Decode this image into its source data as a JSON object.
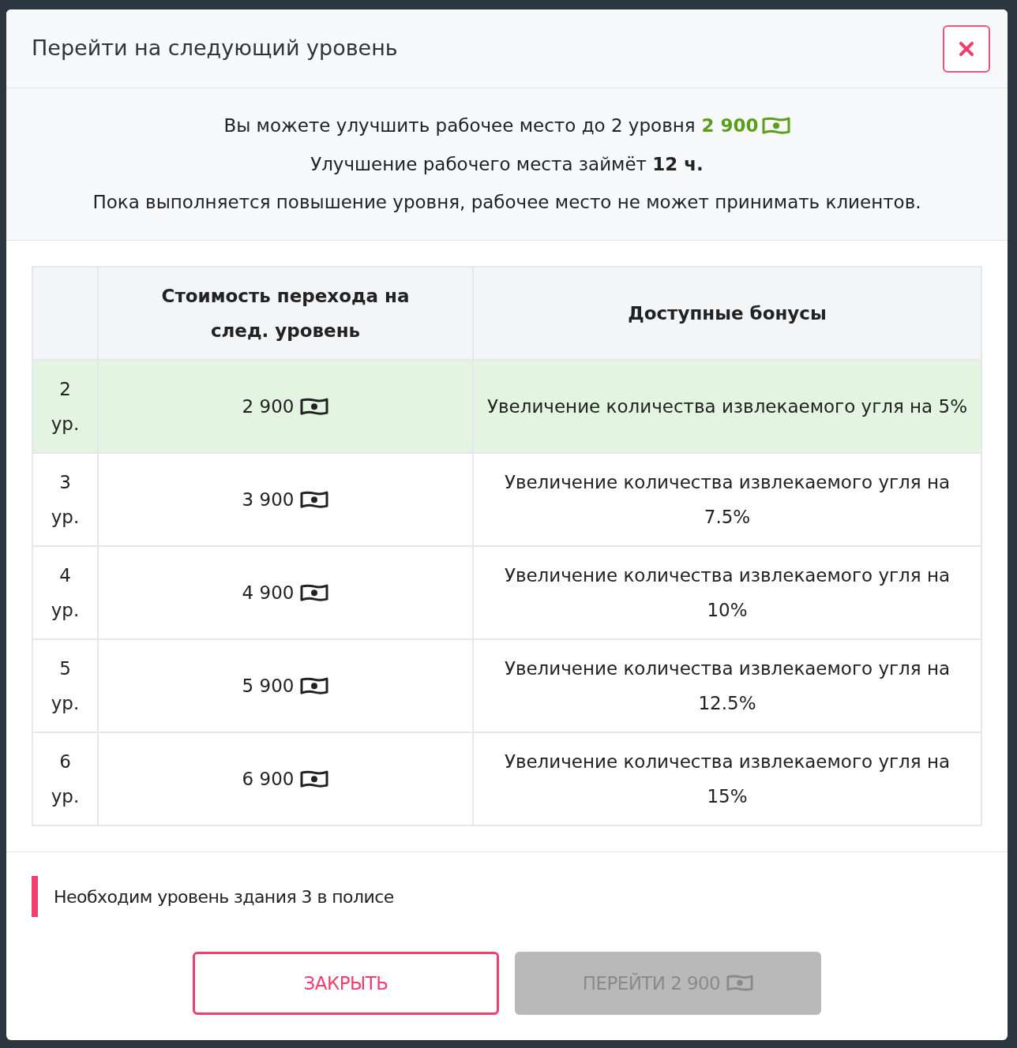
{
  "dialog": {
    "title": "Перейти на следующий уровень"
  },
  "info": {
    "lines": [
      {
        "text": "Вы можете улучшить рабочее место до 2 уровня",
        "price": "2 900"
      },
      {
        "text": "Улучшение рабочего места займёт **12 ч.**"
      },
      {
        "text": "Пока выполняется повышение уровня, рабочее место не может принимать клиентов."
      }
    ]
  },
  "table": {
    "columns": [
      "Стоимость перехода на след. уровень",
      "Доступные бонусы"
    ],
    "rows": [
      {
        "level": "2 ур.",
        "cost": "2 900",
        "bonus": "Увеличение количества извлекаемого угля на 5%",
        "selected": true
      },
      {
        "level": "3 ур.",
        "cost": "3 900",
        "bonus": "Увеличение количества извлекаемого угля на 7.5%",
        "selected": false
      },
      {
        "level": "4 ур.",
        "cost": "4 900",
        "bonus": "Увеличение количества извлекаемого угля на 10%",
        "selected": false
      },
      {
        "level": "5 ур.",
        "cost": "5 900",
        "bonus": "Увеличение количества извлекаемого угля на 12.5%",
        "selected": false
      },
      {
        "level": "6 ур.",
        "cost": "6 900",
        "bonus": "Увеличение количества извлекаемого угля на 15%",
        "selected": false
      }
    ]
  },
  "notice": {
    "text": "Необходим уровень здания 3 в полисе"
  },
  "buttons": [
    {
      "kind": "close",
      "label": "ЗАКРЫТЬ"
    },
    {
      "kind": "upgrade",
      "label": "ПЕРЕЙТИ 2 900",
      "disabled": true
    }
  ]
}
